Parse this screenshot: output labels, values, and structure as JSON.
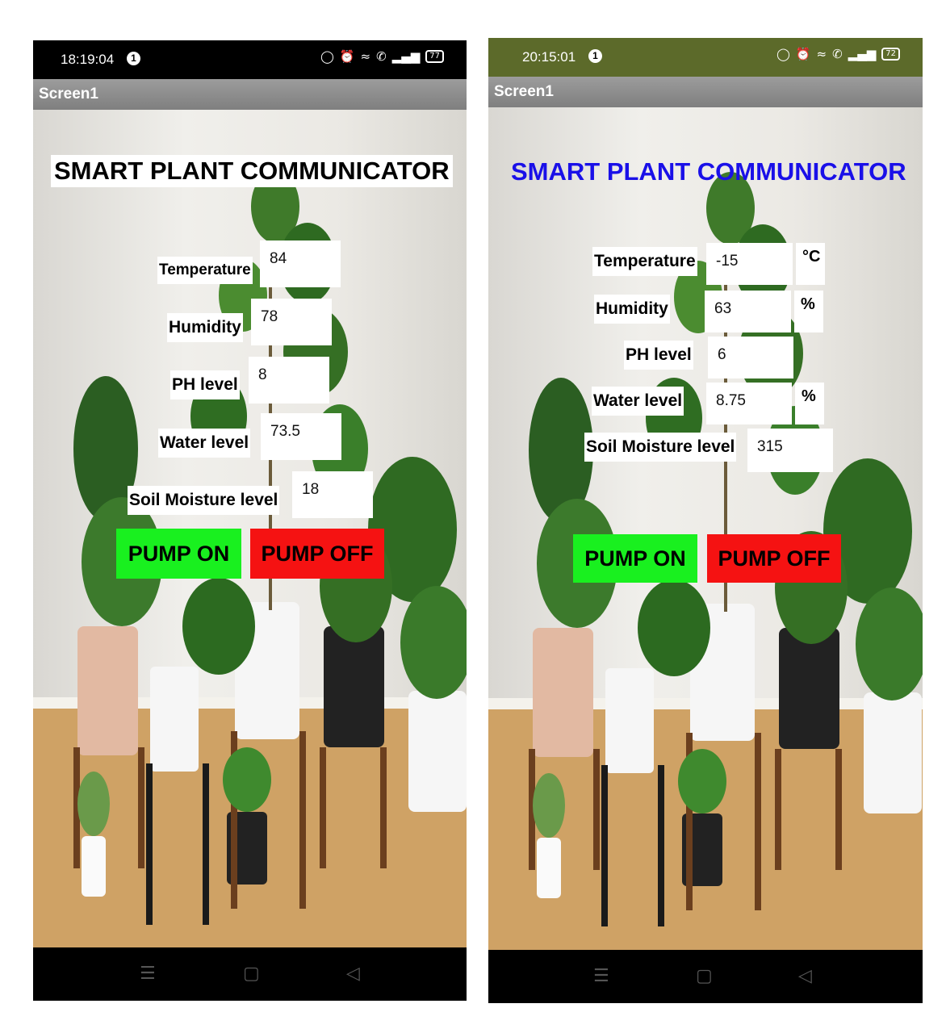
{
  "phones": [
    {
      "status_time": "18:19:04",
      "notification_count": "1",
      "battery": "77",
      "screen_title": "Screen1",
      "app_title": "SMART PLANT COMMUNICATOR",
      "title_color": "#000000",
      "status_bar_color": "#000000",
      "fields": {
        "temperature": {
          "label": "Temperature",
          "value": "84"
        },
        "humidity": {
          "label": "Humidity",
          "value": "78"
        },
        "ph": {
          "label": "PH level",
          "value": "8"
        },
        "water": {
          "label": "Water level",
          "value": "73.5"
        },
        "soil": {
          "label": "Soil Moisture level",
          "value": "18"
        }
      },
      "pump_on_label": "PUMP ON",
      "pump_off_label": "PUMP OFF"
    },
    {
      "status_time": "20:15:01",
      "notification_count": "1",
      "battery": "72",
      "screen_title": "Screen1",
      "app_title": "SMART PLANT COMMUNICATOR",
      "title_color": "#1a10e8",
      "status_bar_color": "#5c6a2a",
      "fields": {
        "temperature": {
          "label": "Temperature",
          "value": "-15",
          "unit": "°C"
        },
        "humidity": {
          "label": "Humidity",
          "value": "63",
          "unit": "%"
        },
        "ph": {
          "label": "PH level",
          "value": "6"
        },
        "water": {
          "label": "Water level",
          "value": "8.75",
          "unit": "%"
        },
        "soil": {
          "label": "Soil Moisture level",
          "value": "315"
        }
      },
      "pump_on_label": "PUMP ON",
      "pump_off_label": "PUMP OFF"
    }
  ],
  "icons": {
    "status": [
      "water-drop-icon",
      "alarm-icon",
      "wifi-icon",
      "call-icon",
      "signal-icon",
      "battery-icon"
    ],
    "nav": [
      "menu-icon",
      "home-icon",
      "back-icon"
    ]
  },
  "colors": {
    "pump_on": "#19f01f",
    "pump_off": "#f51212"
  }
}
